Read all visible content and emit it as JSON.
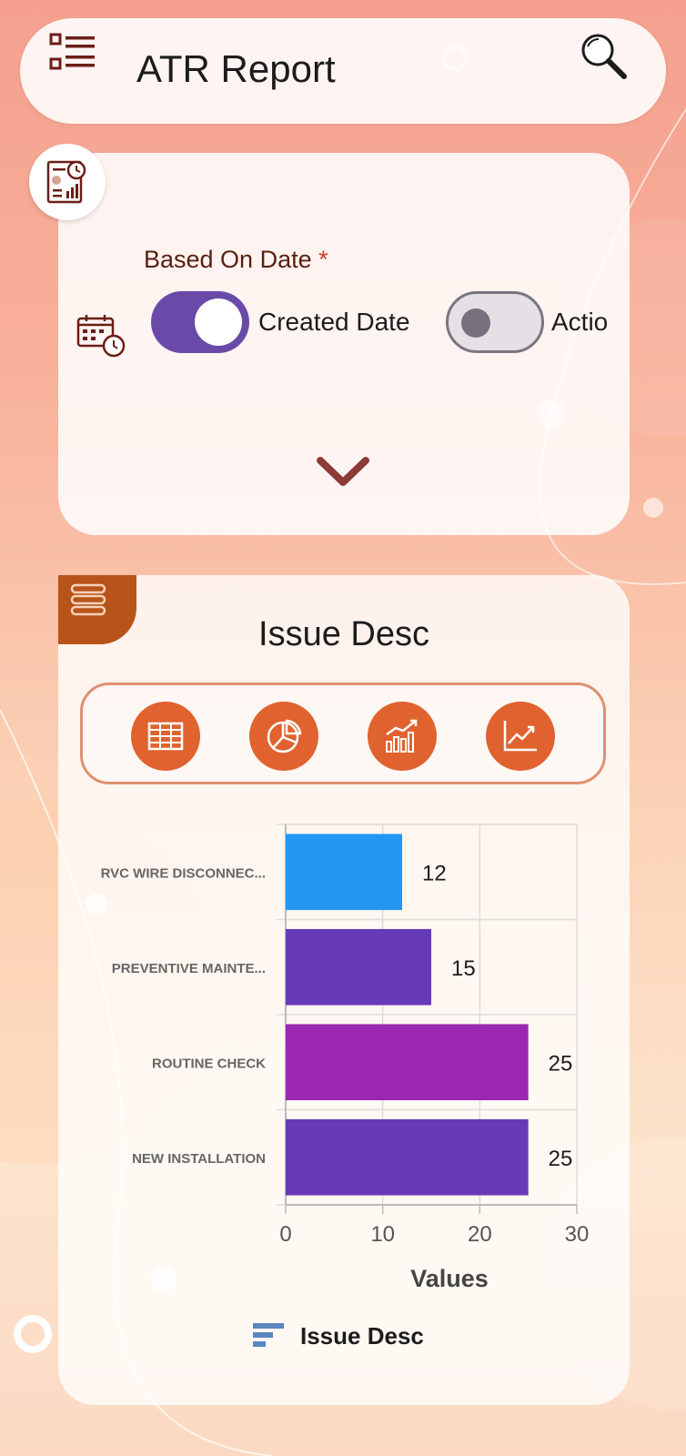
{
  "header": {
    "title": "ATR Report",
    "menu_icon": "list-menu-icon",
    "search_icon": "search-icon"
  },
  "filter": {
    "report_icon": "report-icon",
    "calendar_icon": "calendar-clock-icon",
    "based_on_label": "Based On Date",
    "required_mark": "*",
    "options": [
      {
        "label": "Created Date",
        "enabled": true
      },
      {
        "label": "Action",
        "enabled": false
      }
    ],
    "expand_icon": "chevron-down-icon"
  },
  "chart_panel": {
    "menu_icon": "hamburger-icon",
    "title": "Issue Desc",
    "view_buttons": [
      "table-icon",
      "pie-chart-icon",
      "bar-chart-icon",
      "line-chart-icon"
    ]
  },
  "colors": {
    "accent_orange": "#e0622f",
    "toggle_purple": "#6a4aa8",
    "tab_brown": "#b8541a",
    "bar_blue": "#2196f3",
    "bar_purple": "#673ab7",
    "bar_magenta": "#9c27b0"
  },
  "chart_data": {
    "type": "bar",
    "orientation": "horizontal",
    "categories": [
      "RVC WIRE DISCONNEC...",
      "PREVENTIVE MAINTE...",
      "ROUTINE CHECK",
      "NEW INSTALLATION"
    ],
    "values": [
      12,
      15,
      25,
      25
    ],
    "bar_colors": [
      "#2196f3",
      "#673ab7",
      "#9c27b0",
      "#673ab7"
    ],
    "xlabel": "Values",
    "xlim": [
      0,
      30
    ],
    "xticks": [
      0,
      10,
      20,
      30
    ],
    "grid": true,
    "legend": [
      "Issue Desc"
    ],
    "legend_placement": "bottom"
  }
}
